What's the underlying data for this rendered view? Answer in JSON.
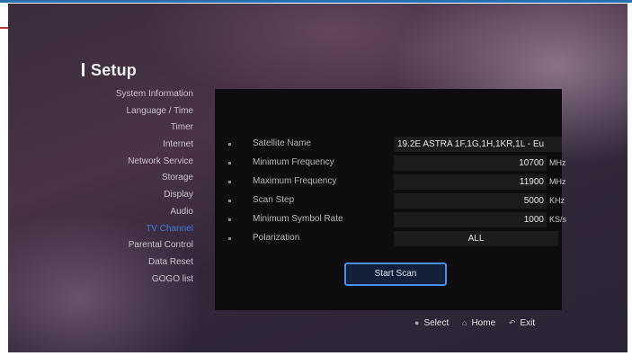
{
  "page": {
    "title": "Setup"
  },
  "menu": {
    "items": [
      {
        "label": "System Information",
        "active": false
      },
      {
        "label": "Language / Time",
        "active": false
      },
      {
        "label": "Timer",
        "active": false
      },
      {
        "label": "Internet",
        "active": false
      },
      {
        "label": "Network Service",
        "active": false
      },
      {
        "label": "Storage",
        "active": false
      },
      {
        "label": "Display",
        "active": false
      },
      {
        "label": "Audio",
        "active": false
      },
      {
        "label": "TV Channel",
        "active": true
      },
      {
        "label": "Parental Control",
        "active": false
      },
      {
        "label": "Data Reset",
        "active": false
      },
      {
        "label": "GOGO list",
        "active": false
      }
    ],
    "active_color": "#3f7fe0"
  },
  "settings": {
    "satellite_name": {
      "label": "Satellite Name",
      "value": "19.2E ASTRA 1F,1G,1H,1KR,1L - Eu"
    },
    "min_frequency": {
      "label": "Minimum Frequency",
      "value": "10700",
      "unit": "MHz"
    },
    "max_frequency": {
      "label": "Maximum Frequency",
      "value": "11900",
      "unit": "MHz"
    },
    "scan_step": {
      "label": "Scan Step",
      "value": "5000",
      "unit": "KHz"
    },
    "min_symbol_rate": {
      "label": "Minimum Symbol Rate",
      "value": "1000",
      "unit": "KS/s"
    },
    "polarization": {
      "label": "Polarization",
      "value": "ALL"
    }
  },
  "start_scan": {
    "label": "Start Scan"
  },
  "hints": {
    "select": {
      "icon": "ok-icon",
      "label": "Select"
    },
    "home": {
      "icon": "home-icon",
      "label": "Home"
    },
    "exit": {
      "icon": "back-arrow-icon",
      "label": "Exit"
    }
  },
  "colors": {
    "accent": "#4b8ee6",
    "panel": "#0d0d0f"
  }
}
